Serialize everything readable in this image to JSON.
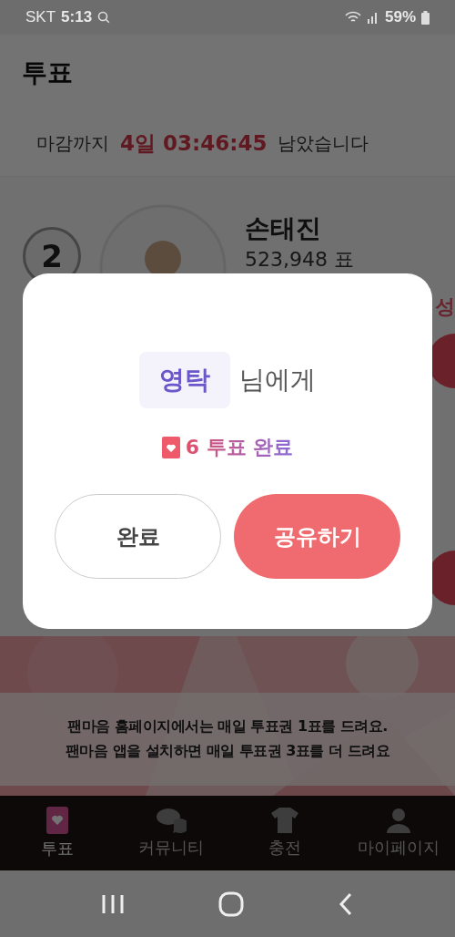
{
  "status_bar": {
    "carrier": "SKT",
    "time": "5:13",
    "battery": "59%"
  },
  "header": {
    "title": "투표"
  },
  "countdown": {
    "prefix": "마감까지",
    "time": "4일 03:46:45",
    "suffix": "남았습니다"
  },
  "ranking": [
    {
      "rank": "2",
      "name": "손태진",
      "votes": "523,948 표",
      "tag": "성"
    }
  ],
  "notice": {
    "lines": [
      "팬마음 홈페이지에서는 매일 투표권 1표를 드려요.",
      "팬마음 앱을 설치하면 매일 투표권 3표를 더 드려요"
    ]
  },
  "bottom_nav": [
    {
      "label": "투표",
      "selected": true
    },
    {
      "label": "커뮤니티",
      "selected": false
    },
    {
      "label": "충전",
      "selected": false
    },
    {
      "label": "마이페이지",
      "selected": false
    }
  ],
  "dialog": {
    "recipient": "영탁",
    "recipient_suffix": "님에게",
    "result": "6 투표 완료",
    "buttons": [
      {
        "label": "완료",
        "kind": "secondary"
      },
      {
        "label": "공유하기",
        "kind": "primary"
      }
    ]
  }
}
